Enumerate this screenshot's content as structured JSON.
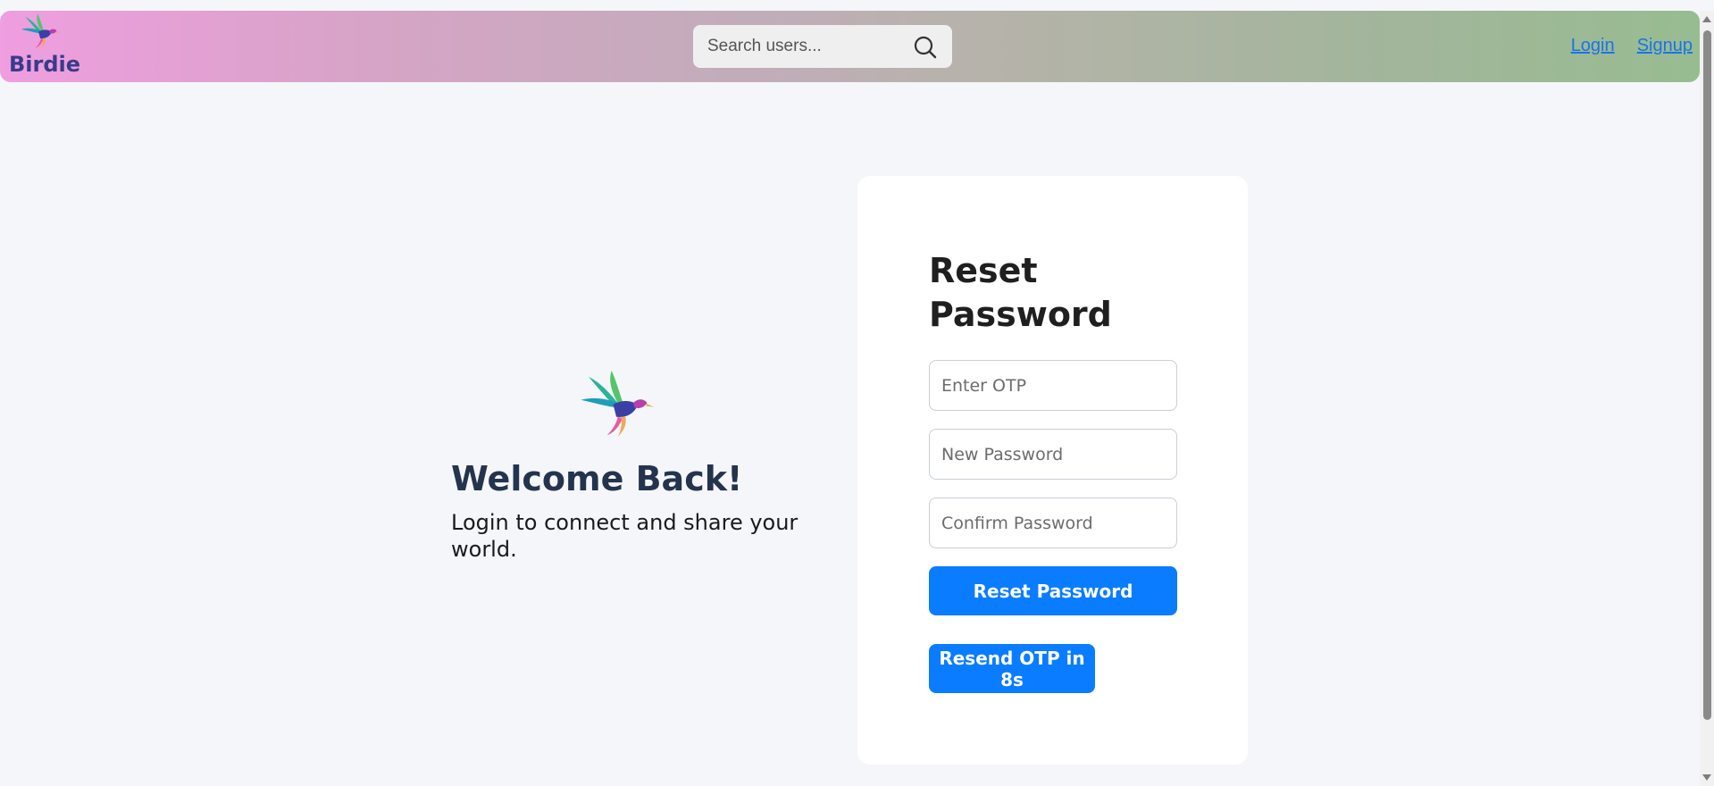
{
  "navbar": {
    "brand_name": "Birdie",
    "search_placeholder": "Search users...",
    "links": {
      "login": "Login",
      "signup": "Signup"
    }
  },
  "welcome": {
    "title": "Welcome Back!",
    "subtitle": "Login to connect and share your world."
  },
  "reset_form": {
    "title": "Reset Password",
    "otp_placeholder": "Enter OTP",
    "otp_value": "",
    "new_password_placeholder": "New Password",
    "new_password_value": "",
    "confirm_password_placeholder": "Confirm Password",
    "confirm_password_value": "",
    "submit_label": "Reset Password",
    "resend_label": "Resend OTP in 8s"
  },
  "colors": {
    "accent": "#0a7cff",
    "brand_text": "#3b3a8c",
    "nav_gradient_start": "#ef9ee0",
    "nav_gradient_end": "#98bc91",
    "page_background": "#f5f6fa",
    "link": "#1a73e8"
  },
  "icons": {
    "brand": "hummingbird-logo-icon",
    "search": "search-icon"
  }
}
